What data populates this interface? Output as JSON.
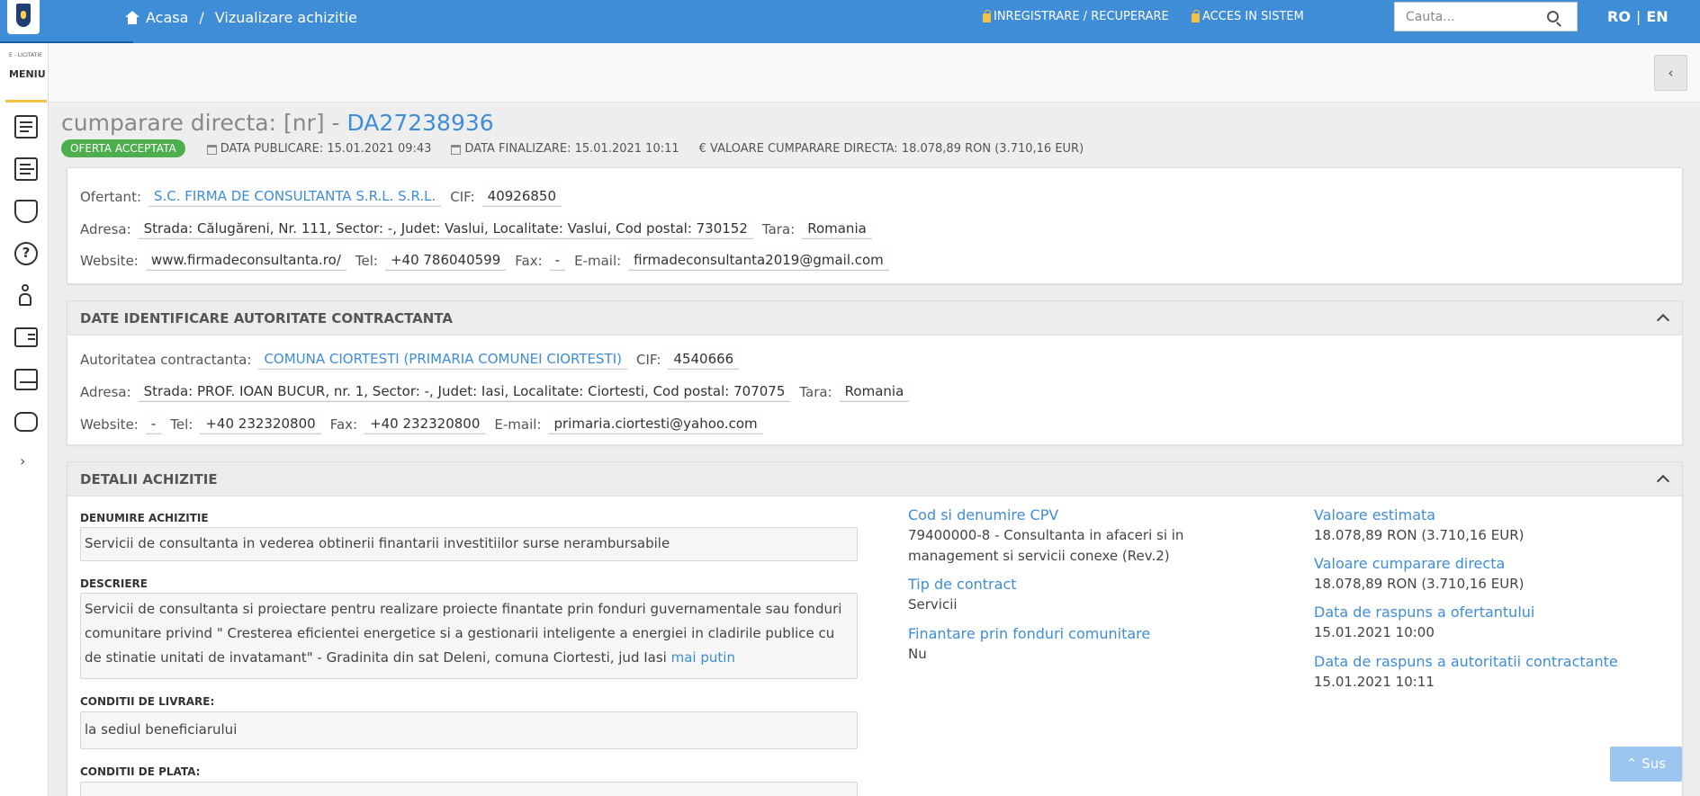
{
  "header": {
    "crumb_home": "Acasa",
    "crumb_sep": "/",
    "crumb_current": "Vizualizare achizitie",
    "link_register": "INREGISTRARE / RECUPERARE",
    "link_login": "ACCES IN SISTEM",
    "search_placeholder": "Cauta...",
    "lang_ro": "RO",
    "lang_sep": "|",
    "lang_en": "EN"
  },
  "sidebar": {
    "brand": "E - LICITATIE",
    "menu_label": "MENIU",
    "icons": [
      "document-icon",
      "list-arrow-icon",
      "shield-check-icon",
      "help-icon",
      "person-icon",
      "contact-card-icon",
      "catalog-icon",
      "chat-bubble-icon"
    ],
    "expand": "›"
  },
  "page": {
    "title_prefix": "cumparare directa: [nr] - ",
    "title_code": "DA27238936",
    "status_badge": "OFERTA ACCEPTATA",
    "publish_label": "DATA PUBLICARE: 15.01.2021 09:43",
    "final_label": "DATA FINALIZARE: 15.01.2021 10:11",
    "value_label": "€ VALOARE CUMPARARE DIRECTA: 18.078,89  RON (3.710,16  EUR)",
    "collapse": "‹"
  },
  "ofertant": {
    "l_ofertant": "Ofertant:",
    "name": "S.C. FIRMA DE CONSULTANTA S.R.L. S.R.L.",
    "l_cif": "CIF:",
    "cif": "40926850",
    "l_adresa": "Adresa:",
    "adresa": "Strada: Călugăreni, Nr. 111, Sector: -, Judet: Vaslui, Localitate: Vaslui, Cod postal: 730152",
    "l_tara": "Tara:",
    "tara": "Romania",
    "l_website": "Website:",
    "website": "www.firmadeconsultanta.ro/",
    "l_tel": "Tel:",
    "tel": "+40 786040599",
    "l_fax": "Fax:",
    "fax": "-",
    "l_email": "E-mail:",
    "email": "firmadeconsultanta2019@gmail.com"
  },
  "autoritate": {
    "heading": "DATE IDENTIFICARE AUTORITATE CONTRACTANTA",
    "l_autoritate": "Autoritatea contractanta:",
    "name": "COMUNA CIORTESTI (PRIMARIA COMUNEI CIORTESTI)",
    "l_cif": "CIF:",
    "cif": "4540666",
    "l_adresa": "Adresa:",
    "adresa": "Strada: PROF. IOAN BUCUR, nr. 1, Sector: -, Judet: Iasi, Localitate: Ciortesti, Cod postal: 707075",
    "l_tara": "Tara:",
    "tara": "Romania",
    "l_website": "Website:",
    "website": "-",
    "l_tel": "Tel:",
    "tel": "+40 232320800",
    "l_fax": "Fax:",
    "fax": "+40 232320800",
    "l_email": "E-mail:",
    "email": "primaria.ciortesti@yahoo.com"
  },
  "detalii": {
    "heading": "DETALII ACHIZITIE",
    "l_denumire": "DENUMIRE ACHIZITIE",
    "denumire": "Servicii de consultanta in vederea obtinerii finantarii investitiilor surse nerambursabile",
    "l_descriere": "DESCRIERE",
    "descriere": "Servicii de consultanta si proiectare pentru realizare proiecte finantate prin fonduri guvernamentale sau fonduri comunitare privind \" Cresterea eficientei energetice si a gestionarii inteligente a energiei in cladirile publice cu de stinatie unitati de invatamant\" - Gradinita din sat Deleni, comuna Ciortesti, jud Iasi",
    "mai_putin": "mai putin",
    "l_livrare": "CONDITII DE LIVRARE:",
    "livrare": "la sediul beneficiarului",
    "l_plata": "CONDITII DE PLATA:",
    "l_cpv": "Cod si denumire CPV",
    "cpv": "79400000-8 - Consultanta in afaceri si in management si servicii conexe (Rev.2)",
    "l_tip": "Tip de contract",
    "tip": "Servicii",
    "l_finantare": "Finantare prin fonduri comunitare",
    "finantare": "Nu",
    "l_estimata": "Valoare estimata",
    "estimata": "18.078,89  RON (3.710,16  EUR)",
    "l_cumparare": "Valoare cumparare directa",
    "cumparare": "18.078,89  RON (3.710,16  EUR)",
    "l_raspuns_of": "Data de raspuns a ofertantului",
    "raspuns_of": "15.01.2021 10:00",
    "l_raspuns_ac": "Data de raspuns a autoritatii contractante",
    "raspuns_ac": "15.01.2021 10:11"
  },
  "scroll_top": "Sus"
}
